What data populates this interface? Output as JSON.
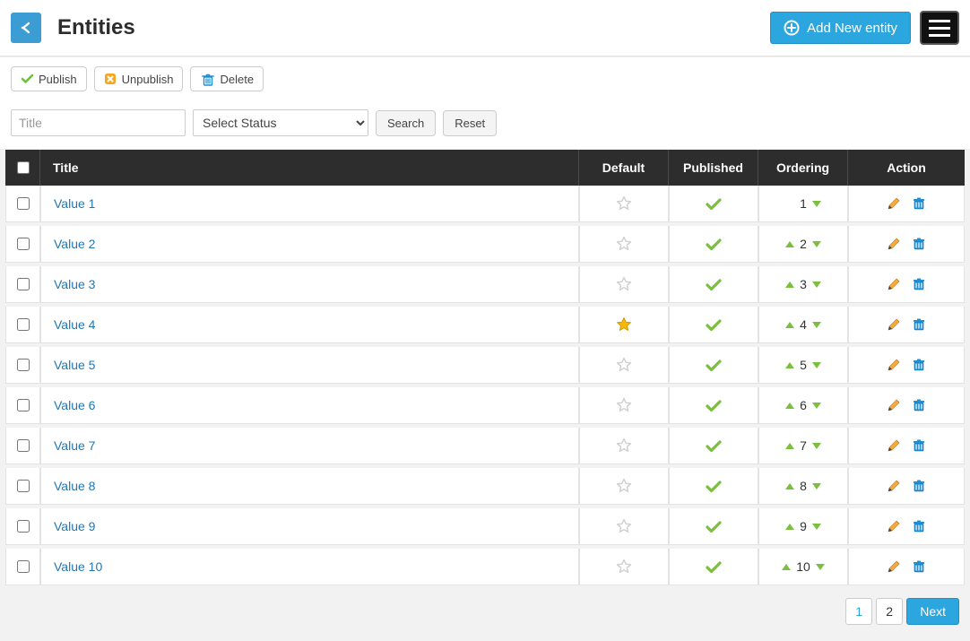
{
  "header": {
    "title": "Entities",
    "add_new_label": "Add New entity"
  },
  "toolbar": {
    "publish": "Publish",
    "unpublish": "Unpublish",
    "delete": "Delete"
  },
  "filters": {
    "title_placeholder": "Title",
    "status_placeholder": "Select Status",
    "search_label": "Search",
    "reset_label": "Reset"
  },
  "columns": {
    "title": "Title",
    "default": "Default",
    "published": "Published",
    "ordering": "Ordering",
    "action": "Action"
  },
  "rows": [
    {
      "title": "Value 1",
      "default": false,
      "published": true,
      "order": 1,
      "first": true,
      "last": false
    },
    {
      "title": "Value 2",
      "default": false,
      "published": true,
      "order": 2,
      "first": false,
      "last": false
    },
    {
      "title": "Value 3",
      "default": false,
      "published": true,
      "order": 3,
      "first": false,
      "last": false
    },
    {
      "title": "Value 4",
      "default": true,
      "published": true,
      "order": 4,
      "first": false,
      "last": false
    },
    {
      "title": "Value 5",
      "default": false,
      "published": true,
      "order": 5,
      "first": false,
      "last": false
    },
    {
      "title": "Value 6",
      "default": false,
      "published": true,
      "order": 6,
      "first": false,
      "last": false
    },
    {
      "title": "Value 7",
      "default": false,
      "published": true,
      "order": 7,
      "first": false,
      "last": false
    },
    {
      "title": "Value 8",
      "default": false,
      "published": true,
      "order": 8,
      "first": false,
      "last": false
    },
    {
      "title": "Value 9",
      "default": false,
      "published": true,
      "order": 9,
      "first": false,
      "last": false
    },
    {
      "title": "Value 10",
      "default": false,
      "published": true,
      "order": 10,
      "first": false,
      "last": false
    }
  ],
  "pagination": {
    "pages": [
      "1",
      "2"
    ],
    "current": "1",
    "next_label": "Next"
  }
}
